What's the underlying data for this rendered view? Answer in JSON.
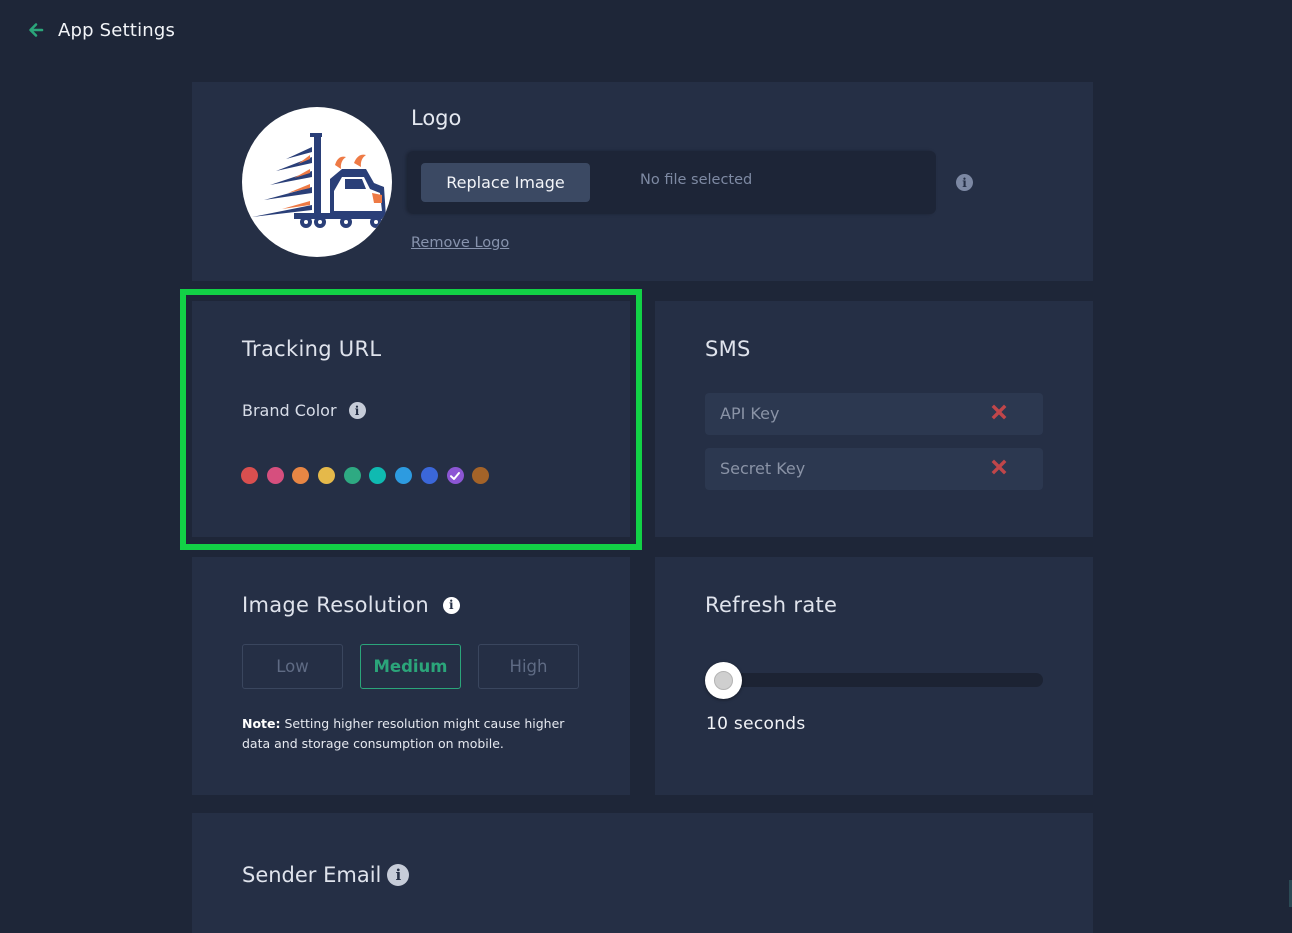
{
  "header": {
    "title": "App Settings",
    "back_icon": "arrow-left-icon",
    "accent_color": "#2ba57a"
  },
  "logo_section": {
    "title": "Logo",
    "logo_image": "truck-logo",
    "replace_button_label": "Replace Image",
    "file_status": "No file selected",
    "info_icon": "info-icon",
    "remove_link_label": "Remove Logo"
  },
  "tracking_url": {
    "title": "Tracking URL",
    "brand_color_label": "Brand Color",
    "info_icon": "info-icon",
    "selected_index": 8,
    "swatches": [
      {
        "name": "red",
        "color": "#d94f4f"
      },
      {
        "name": "pink",
        "color": "#d64f7e"
      },
      {
        "name": "orange",
        "color": "#e88644"
      },
      {
        "name": "yellow",
        "color": "#e5b94a"
      },
      {
        "name": "green",
        "color": "#2eaa82"
      },
      {
        "name": "teal",
        "color": "#0fbab1"
      },
      {
        "name": "sky-blue",
        "color": "#2d9be0"
      },
      {
        "name": "blue",
        "color": "#3b67d9"
      },
      {
        "name": "purple",
        "color": "#8c56d4"
      },
      {
        "name": "brown",
        "color": "#a46328"
      }
    ],
    "highlight_color": "#12d146"
  },
  "sms": {
    "title": "SMS",
    "fields": [
      {
        "label": "API Key",
        "clear_icon": "close-x-icon"
      },
      {
        "label": "Secret Key",
        "clear_icon": "close-x-icon"
      }
    ],
    "clear_color": "#c0464a"
  },
  "image_resolution": {
    "title": "Image Resolution",
    "info_icon": "info-icon",
    "options": [
      "Low",
      "Medium",
      "High"
    ],
    "selected": "Medium",
    "note_label": "Note:",
    "note_text": " Setting higher resolution might cause higher data and storage consumption on mobile."
  },
  "refresh_rate": {
    "title": "Refresh rate",
    "slider_fraction": 0.0,
    "value_label": "10 seconds"
  },
  "sender_email": {
    "title": "Sender Email",
    "info_icon": "info-icon"
  }
}
